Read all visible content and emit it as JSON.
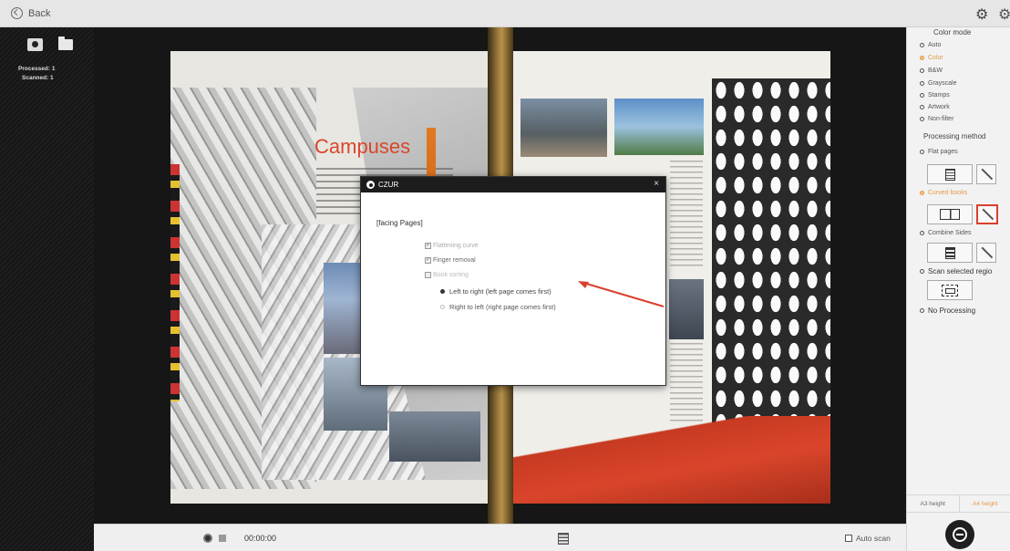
{
  "topbar": {
    "back_label": "Back"
  },
  "left_panel": {
    "processed_label": "Processed: 1",
    "scanned_label": "Scanned: 1"
  },
  "document": {
    "headline": "Campuses"
  },
  "dialog": {
    "title": "CZUR",
    "close_symbol": "×",
    "section_title": "[facing Pages]",
    "options": [
      {
        "label": "Flattening curve",
        "checked": true
      },
      {
        "label": "Finger removal",
        "checked": true
      },
      {
        "label": "Book sorting",
        "checked": false
      }
    ],
    "radio_options": [
      {
        "label": "Left to right (left page comes first)",
        "selected": true
      },
      {
        "label": "Right to left (right page comes first)",
        "selected": false
      }
    ]
  },
  "bottom_bar": {
    "timer": "00:00:00",
    "autoscan_label": "Auto scan"
  },
  "right_panel": {
    "color_mode_title": "Color mode",
    "color_modes": [
      {
        "label": "Auto",
        "selected": false
      },
      {
        "label": "Color",
        "selected": true
      },
      {
        "label": "B&W",
        "selected": false
      },
      {
        "label": "Grayscale",
        "selected": false
      },
      {
        "label": "Stamps",
        "selected": false
      },
      {
        "label": "Artwork",
        "selected": false
      },
      {
        "label": "Non-filter",
        "selected": false
      }
    ],
    "processing_title": "Processing method",
    "methods": {
      "flat": "Flat pages",
      "curved": "Curved books",
      "combine": "Combine Sides",
      "scan_region": "Scan selected regio",
      "none": "No Processing"
    },
    "tabs": [
      "A3 height",
      "A4 height"
    ]
  },
  "colors": {
    "accent_orange": "#e39b4a",
    "highlight_red": "#d9402e",
    "headline_red": "#d9472b"
  }
}
